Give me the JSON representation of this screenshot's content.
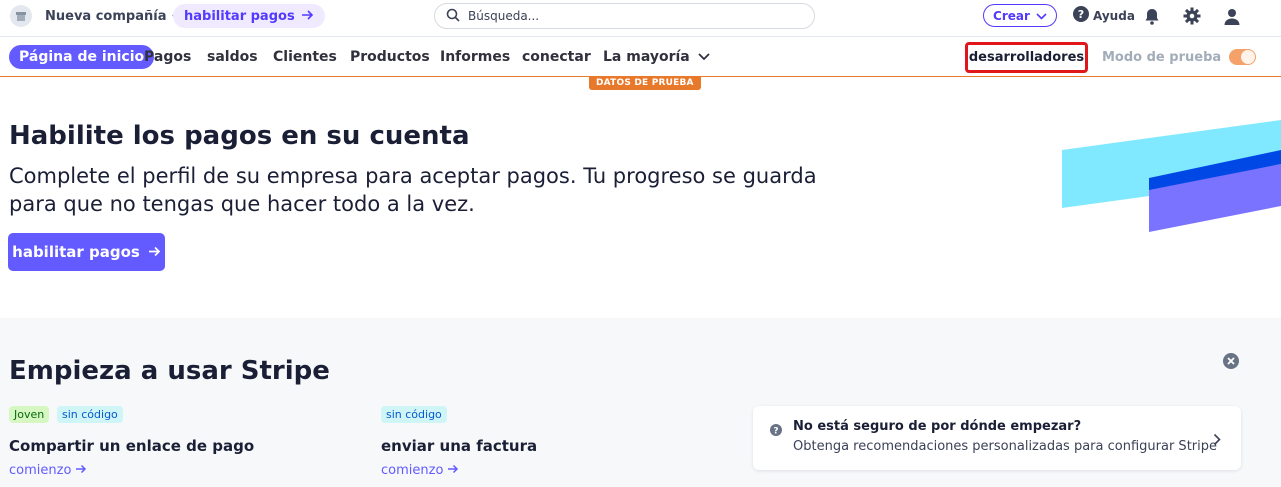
{
  "topbar": {
    "company_name": "Nueva compañía",
    "activate_label": "habilitar pagos",
    "search_placeholder": "Búsqueda...",
    "create_label": "Crear",
    "help_label": "Ayuda",
    "icons": [
      "store-icon",
      "chevron-down-icon",
      "arrow-right-icon",
      "search-icon",
      "help-icon",
      "bell-icon",
      "gear-icon",
      "user-icon"
    ]
  },
  "nav": {
    "items": [
      "Página de inicio",
      "Pagos",
      "saldos",
      "Clientes",
      "Productos",
      "Informes",
      "conectar",
      "La mayoría"
    ],
    "developers": "desarrolladores",
    "test_mode": "Modo de prueba",
    "test_mode_on": true,
    "test_badge": "DATOS DE PRUEBA"
  },
  "hero": {
    "title": "Habilite los pagos en su cuenta",
    "description": "Complete el perfil de su empresa para aceptar pagos. Tu progreso se guarda para que no tengas que hacer todo a la vez.",
    "button": "habilitar pagos"
  },
  "getting_started": {
    "title": "Empieza a usar Stripe",
    "cards": [
      {
        "tags": [
          "Joven",
          "sin código"
        ],
        "title": "Compartir un enlace de pago",
        "link": "comienzo"
      },
      {
        "tags": [
          "sin código"
        ],
        "title": "enviar una factura",
        "link": "comienzo"
      }
    ],
    "recommendation": {
      "title": "No está seguro de por dónde empezar?",
      "subtitle": "Obtenga recomendaciones personalizadas para configurar Stripe"
    }
  },
  "colors": {
    "accent": "#635bff",
    "test_orange": "#e8782a",
    "highlight_red": "#e0161b"
  }
}
